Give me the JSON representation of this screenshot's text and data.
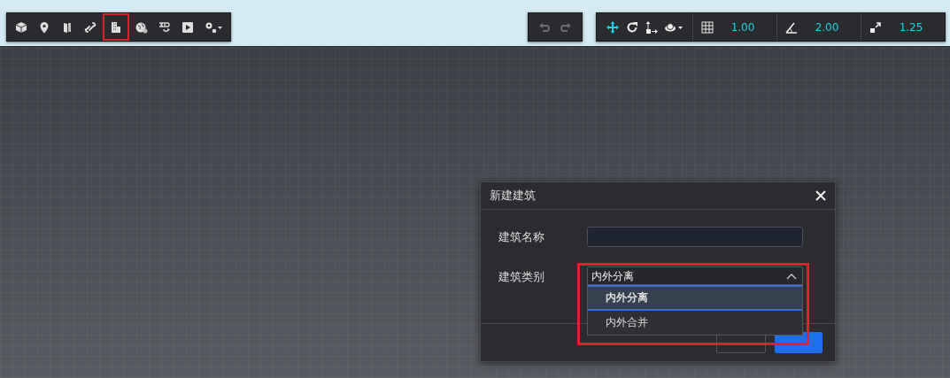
{
  "main_toolbar": {
    "tools": [
      {
        "selected": false
      },
      {
        "selected": false
      },
      {
        "selected": false
      },
      {
        "selected": false
      },
      {
        "selected": true
      },
      {
        "selected": false
      },
      {
        "selected": false
      },
      {
        "selected": false
      },
      {
        "selected": false
      }
    ]
  },
  "history": {
    "undo": {
      "disabled": true
    },
    "redo": {
      "disabled": true
    }
  },
  "transform_toolbar": {
    "tools": [
      {
        "selected": true
      },
      {
        "selected": false
      },
      {
        "selected": false
      },
      {
        "selected": false
      }
    ],
    "grid_step": "1.00",
    "angle_step": "2.00",
    "scale_step": "1.25"
  },
  "dialog": {
    "title": "新建建筑",
    "fields": [
      {
        "kind": "text",
        "label": "建筑名称"
      },
      {
        "kind": "select",
        "label": "建筑类别",
        "value": "内外分离",
        "expanded": true,
        "highlighted": true,
        "options": [
          {
            "label": "内外分离",
            "selected": true
          },
          {
            "label": "内外合并",
            "selected": false
          }
        ]
      }
    ]
  }
}
